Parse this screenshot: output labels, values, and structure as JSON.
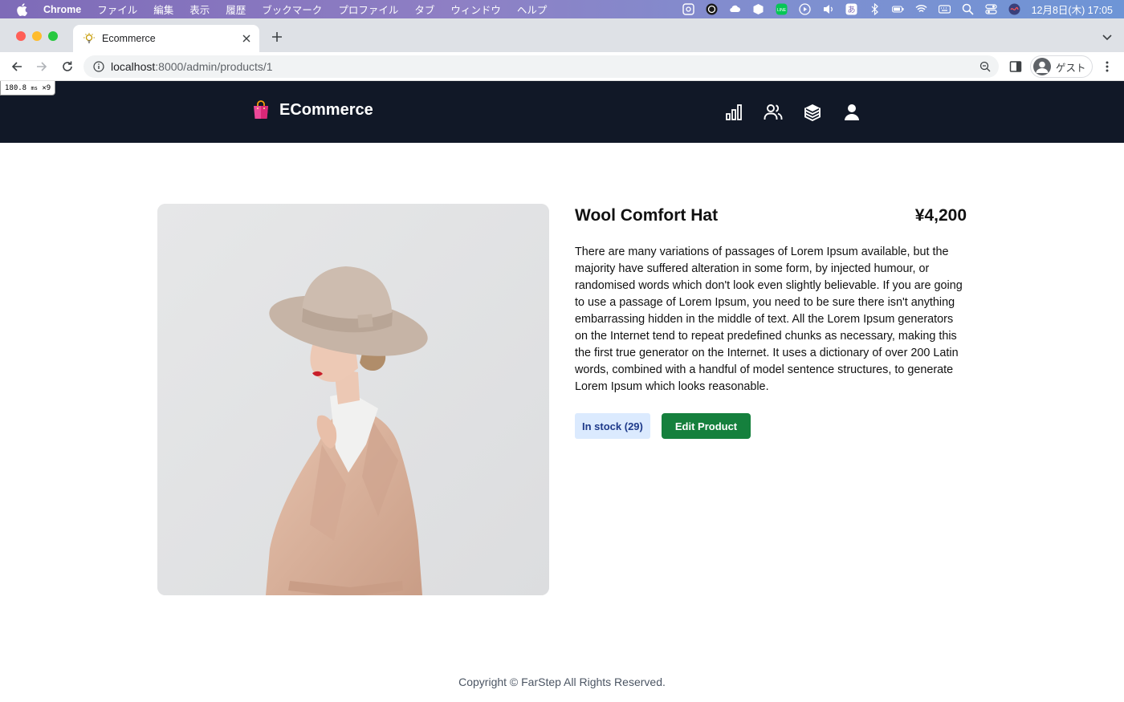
{
  "menubar": {
    "app_name": "Chrome",
    "items": [
      "ファイル",
      "編集",
      "表示",
      "履歴",
      "ブックマーク",
      "プロファイル",
      "タブ",
      "ウィンドウ",
      "ヘルプ"
    ],
    "clock": "12月8日(木) 17:05"
  },
  "browser": {
    "tab_title": "Ecommerce",
    "url_host": "localhost",
    "url_rest": ":8000/admin/products/1",
    "profile_name": "ゲスト"
  },
  "perf_overlay": {
    "time": "180.8",
    "unit": "ms",
    "count": "✕9"
  },
  "header": {
    "brand": "ECommerce",
    "nav_icons": [
      "chart-icon",
      "users-icon",
      "products-box-icon",
      "account-icon"
    ]
  },
  "product": {
    "name": "Wool Comfort Hat",
    "price": "¥4,200",
    "description": "There are many variations of passages of Lorem Ipsum available, but the majority have suffered alteration in some form, by injected humour, or randomised words which don't look even slightly believable. If you are going to use a passage of Lorem Ipsum, you need to be sure there isn't anything embarrassing hidden in the middle of text. All the Lorem Ipsum generators on the Internet tend to repeat predefined chunks as necessary, making this the first true generator on the Internet. It uses a dictionary of over 200 Latin words, combined with a handful of model sentence structures, to generate Lorem Ipsum which looks reasonable.",
    "stock_label": "In stock (29)",
    "edit_label": "Edit Product"
  },
  "footer": {
    "copyright": "Copyright © FarStep All Rights Reserved."
  },
  "colors": {
    "header_bg": "#111827",
    "edit_button": "#15803d",
    "stock_badge_bg": "#dbeafe",
    "stock_badge_text": "#1e3a8a"
  }
}
